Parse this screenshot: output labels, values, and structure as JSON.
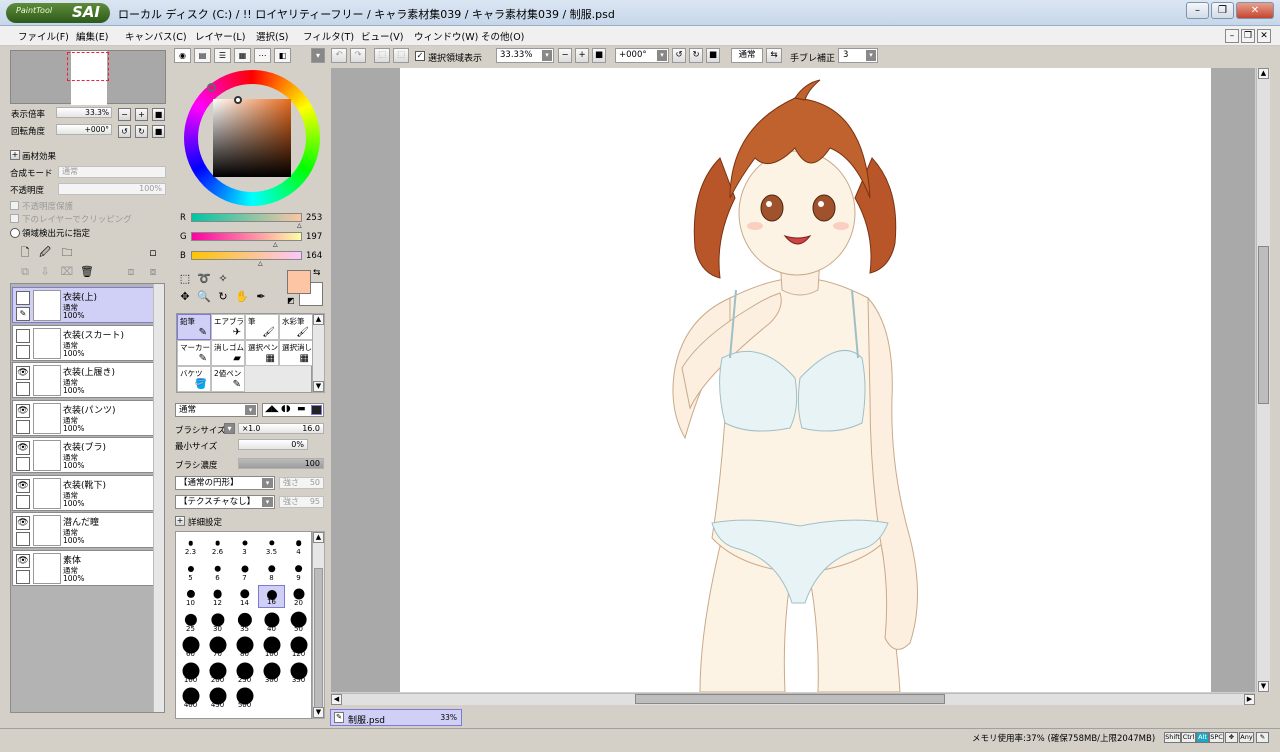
{
  "window": {
    "app_logo_small": "PaintTool",
    "app_logo_big": "SAI",
    "title": "ローカル ディスク (C:) / !! ロイヤリティーフリー / キャラ素材集039 / キャラ素材集039 / 制服.psd",
    "controls": {
      "minimize": "–",
      "restore": "❐",
      "close": "✕"
    }
  },
  "menu": [
    "ファイル(F)",
    "編集(E)",
    "キャンバス(C)",
    "レイヤー(L)",
    "選択(S)",
    "フィルタ(T)",
    "ビュー(V)",
    "ウィンドウ(W)",
    "その他(O)"
  ],
  "navigator": {
    "zoom_label": "表示倍率",
    "zoom_value": "33.3%",
    "rotate_label": "回転角度",
    "rotate_value": "+000°"
  },
  "layer_props": {
    "section": "画材効果",
    "blend_label": "合成モード",
    "blend_value": "通常",
    "opacity_label": "不透明度",
    "opacity_value": "100%",
    "preserve_opacity": "不透明度保護",
    "clip_lower": "下のレイヤーでクリッピング",
    "selection_source": "領域検出元に指定"
  },
  "layers": [
    {
      "name": "衣装(上)",
      "mode": "通常",
      "opacity": "100%",
      "visible": false,
      "selected": true
    },
    {
      "name": "衣装(スカート)",
      "mode": "通常",
      "opacity": "100%",
      "visible": false,
      "selected": false
    },
    {
      "name": "衣装(上履き)",
      "mode": "通常",
      "opacity": "100%",
      "visible": true,
      "selected": false
    },
    {
      "name": "衣装(パンツ)",
      "mode": "通常",
      "opacity": "100%",
      "visible": true,
      "selected": false
    },
    {
      "name": "衣装(ブラ)",
      "mode": "通常",
      "opacity": "100%",
      "visible": true,
      "selected": false
    },
    {
      "name": "衣装(靴下)",
      "mode": "通常",
      "opacity": "100%",
      "visible": true,
      "selected": false
    },
    {
      "name": "潜んだ瞳",
      "mode": "通常",
      "opacity": "100%",
      "visible": true,
      "selected": false
    },
    {
      "name": "素体",
      "mode": "通常",
      "opacity": "100%",
      "visible": true,
      "selected": false
    }
  ],
  "color": {
    "r_label": "R",
    "r_value": "253",
    "g_label": "G",
    "g_value": "197",
    "b_label": "B",
    "b_value": "164",
    "fg": "#fdc5a4",
    "bg": "#ffffff"
  },
  "brushes": [
    {
      "name": "鉛筆",
      "icon": "✎",
      "selected": true
    },
    {
      "name": "エアブラシ",
      "icon": "✈",
      "selected": false
    },
    {
      "name": "筆",
      "icon": "🖌",
      "selected": false
    },
    {
      "name": "水彩筆",
      "icon": "🖌",
      "selected": false
    },
    {
      "name": "マーカー",
      "icon": "✎",
      "selected": false
    },
    {
      "name": "消しゴム",
      "icon": "▰",
      "selected": false
    },
    {
      "name": "選択ペン",
      "icon": "▦",
      "selected": false
    },
    {
      "name": "選択消し",
      "icon": "▦",
      "selected": false
    },
    {
      "name": "バケツ",
      "icon": "🪣",
      "selected": false
    },
    {
      "name": "2値ペン",
      "icon": "✎",
      "selected": false
    }
  ],
  "brush_settings": {
    "mode": "通常",
    "size_label": "ブラシサイズ",
    "size_multiplier": "×1.0",
    "size_value": "16.0",
    "min_size_label": "最小サイズ",
    "min_size_value": "0%",
    "density_label": "ブラシ濃度",
    "density_value": "100",
    "shape": "【通常の円形】",
    "shape_strength_label": "強さ",
    "shape_strength": "50",
    "texture": "【テクスチャなし】",
    "texture_strength_label": "強さ",
    "texture_strength": "95",
    "advanced": "詳細設定"
  },
  "sizes": [
    "2.3",
    "2.6",
    "3",
    "3.5",
    "4",
    "5",
    "6",
    "7",
    "8",
    "9",
    "10",
    "12",
    "14",
    "16",
    "20",
    "25",
    "30",
    "35",
    "40",
    "50",
    "60",
    "70",
    "80",
    "100",
    "120",
    "160",
    "200",
    "250",
    "300",
    "350",
    "400",
    "450",
    "500"
  ],
  "selected_size": "16",
  "canvas_toolbar": {
    "show_selection": "選択領域表示",
    "zoom": "33.33%",
    "rotation": "+000°",
    "mode": "通常",
    "stabilizer_label": "手ブレ補正",
    "stabilizer_value": "3"
  },
  "doc_tab": {
    "name": "制服.psd",
    "zoom": "33%"
  },
  "status": {
    "memory": "メモリ使用率:37% (確保758MB/上限2047MB)",
    "keys": [
      "Shift",
      "Ctrl",
      "Alt",
      "SPC",
      "✥",
      "Any",
      "✎"
    ]
  }
}
